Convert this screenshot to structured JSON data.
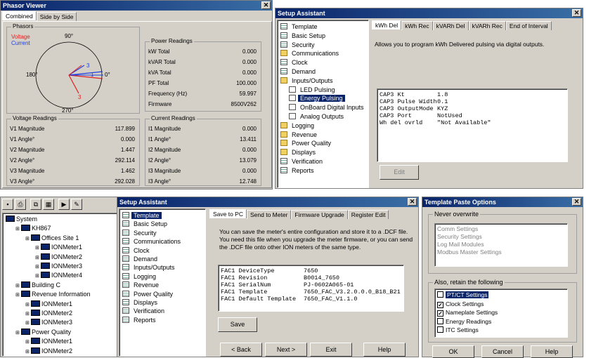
{
  "phasor": {
    "title": "Phasor Viewer",
    "tabs": [
      "Combined",
      "Side by Side"
    ],
    "phasors_group": "Phasors",
    "legend_voltage": "Voltage",
    "legend_current": "Current",
    "angle_90": "90°",
    "angle_180": "180°",
    "angle_0": "0°",
    "angle_270": "270°",
    "label_3a": "3",
    "label_1": "1",
    "label_3b": "3",
    "power_group": "Power Readings",
    "power": [
      {
        "label": "kW Total",
        "value": "0.000"
      },
      {
        "label": "kVAR Total",
        "value": "0.000"
      },
      {
        "label": "kVA Total",
        "value": "0.000"
      },
      {
        "label": "PF Total",
        "value": "100.000"
      },
      {
        "label": "Frequency (Hz)",
        "value": "59.997"
      },
      {
        "label": "Firmware",
        "value": "8500V262"
      }
    ],
    "voltage_group": "Voltage Readings",
    "voltage": [
      {
        "label": "V1 Magnitude",
        "value": "117.899"
      },
      {
        "label": "V1 Angle°",
        "value": "0.000"
      },
      {
        "label": "V2 Magnitude",
        "value": "1.447"
      },
      {
        "label": "V2 Angle°",
        "value": "292.114"
      },
      {
        "label": "V3 Magnitude",
        "value": "1.462"
      },
      {
        "label": "V3 Angle°",
        "value": "292.028"
      }
    ],
    "current_group": "Current Readings",
    "current": [
      {
        "label": "I1 Magnitude",
        "value": "0.000"
      },
      {
        "label": "I1 Angle°",
        "value": "13.411"
      },
      {
        "label": "I2 Magnitude",
        "value": "0.000"
      },
      {
        "label": "I2 Angle°",
        "value": "13.079"
      },
      {
        "label": "I3 Magnitude",
        "value": "0.000"
      },
      {
        "label": "I3 Angle°",
        "value": "12.748"
      }
    ]
  },
  "setup1": {
    "title": "Setup Assistant",
    "nav": [
      {
        "label": "Template",
        "icon": "page"
      },
      {
        "label": "Basic Setup",
        "icon": "page"
      },
      {
        "label": "Security",
        "icon": "page"
      },
      {
        "label": "Communications",
        "icon": "folder"
      },
      {
        "label": "Clock",
        "icon": "page"
      },
      {
        "label": "Demand",
        "icon": "page"
      },
      {
        "label": "Inputs/Outputs",
        "icon": "folder"
      },
      {
        "label": "LED Pulsing",
        "icon": "sub"
      },
      {
        "label": "Energy Pulsing",
        "icon": "sub"
      },
      {
        "label": "OnBoard Digital Inputs",
        "icon": "sub"
      },
      {
        "label": "Analog Outputs",
        "icon": "sub"
      },
      {
        "label": "Logging",
        "icon": "folder"
      },
      {
        "label": "Revenue",
        "icon": "folder"
      },
      {
        "label": "Power Quality",
        "icon": "folder"
      },
      {
        "label": "Displays",
        "icon": "folder"
      },
      {
        "label": "Verification",
        "icon": "page"
      },
      {
        "label": "Reports",
        "icon": "page"
      }
    ],
    "tabs": [
      "kWh Del",
      "kWh Rec",
      "kVARh Del",
      "kVARh Rec",
      "End of Interval"
    ],
    "description": "Allows you to program kWh Delivered pulsing via digital outputs.",
    "params": [
      {
        "name": "CAP3 Kt",
        "value": "1.8"
      },
      {
        "name": "CAP3 Pulse Width",
        "value": "0.1"
      },
      {
        "name": "CAP3 OutputMode",
        "value": "KYZ"
      },
      {
        "name": "CAP3 Port",
        "value": "NotUsed"
      },
      {
        "name": "Wh del ovrld",
        "value": "\"Not Available\""
      }
    ],
    "edit_label": "Edit"
  },
  "tree": {
    "items": [
      {
        "label": "System",
        "indent": 0
      },
      {
        "label": "KH867",
        "indent": 1
      },
      {
        "label": "Offices Site 1",
        "indent": 2
      },
      {
        "label": "IONMeter1",
        "indent": 3
      },
      {
        "label": "IONMeter2",
        "indent": 3
      },
      {
        "label": "IONMeter3",
        "indent": 3
      },
      {
        "label": "IONMeter4",
        "indent": 3
      },
      {
        "label": "Building C",
        "indent": 1
      },
      {
        "label": "Revenue Information",
        "indent": 1
      },
      {
        "label": "IONMeter1",
        "indent": 2
      },
      {
        "label": "IONMeter2",
        "indent": 2
      },
      {
        "label": "IONMeter3",
        "indent": 2
      },
      {
        "label": "Power Quality",
        "indent": 1
      },
      {
        "label": "IONMeter1",
        "indent": 2
      },
      {
        "label": "IONMeter2",
        "indent": 2
      }
    ]
  },
  "setup2": {
    "title": "Setup Assistant",
    "nav": [
      "Template",
      "Basic Setup",
      "Security",
      "Communications",
      "Clock",
      "Demand",
      "Inputs/Outputs",
      "Logging",
      "Revenue",
      "Power Quality",
      "Displays",
      "Verification",
      "Reports"
    ],
    "tabs": [
      "Save to PC",
      "Send to Meter",
      "Firmware Upgrade",
      "Register Edit"
    ],
    "description": "You can save the meter's entire configuration and store it to a .DCF file. You need this file when you upgrade the meter firmware, or you can send the .DCF file onto other ION meters of the same type.",
    "params": [
      {
        "name": "FAC1 DeviceType",
        "value": "7650"
      },
      {
        "name": "FAC1 Revision",
        "value": "B0014_7650"
      },
      {
        "name": "FAC1 SerialNum",
        "value": "PJ-0602A065-01"
      },
      {
        "name": "FAC1 Template",
        "value": "7650_FAC_V3.2.0.0.0_B18_B21"
      },
      {
        "name": "FAC1 Default Template",
        "value": "7650_FAC_V1.1.0"
      }
    ],
    "save_label": "Save",
    "back_label": "< Back",
    "next_label": "Next >",
    "exit_label": "Exit",
    "help_label": "Help"
  },
  "paste": {
    "title": "Template Paste Options",
    "never_group": "Never overwrite",
    "never": [
      "Comm Settings",
      "Security Settings",
      "Log Mail Modules",
      "Modbus Master Settings"
    ],
    "retain_group": "Also, retain the following",
    "retain": [
      {
        "label": "PT/CT Settings",
        "checked": false
      },
      {
        "label": "Clock Settings",
        "checked": true
      },
      {
        "label": "Nameplate Settings",
        "checked": true
      },
      {
        "label": "Energy Readings",
        "checked": false
      },
      {
        "label": "ITC Settings",
        "checked": false
      }
    ],
    "ok_label": "OK",
    "cancel_label": "Cancel",
    "help_label": "Help"
  }
}
